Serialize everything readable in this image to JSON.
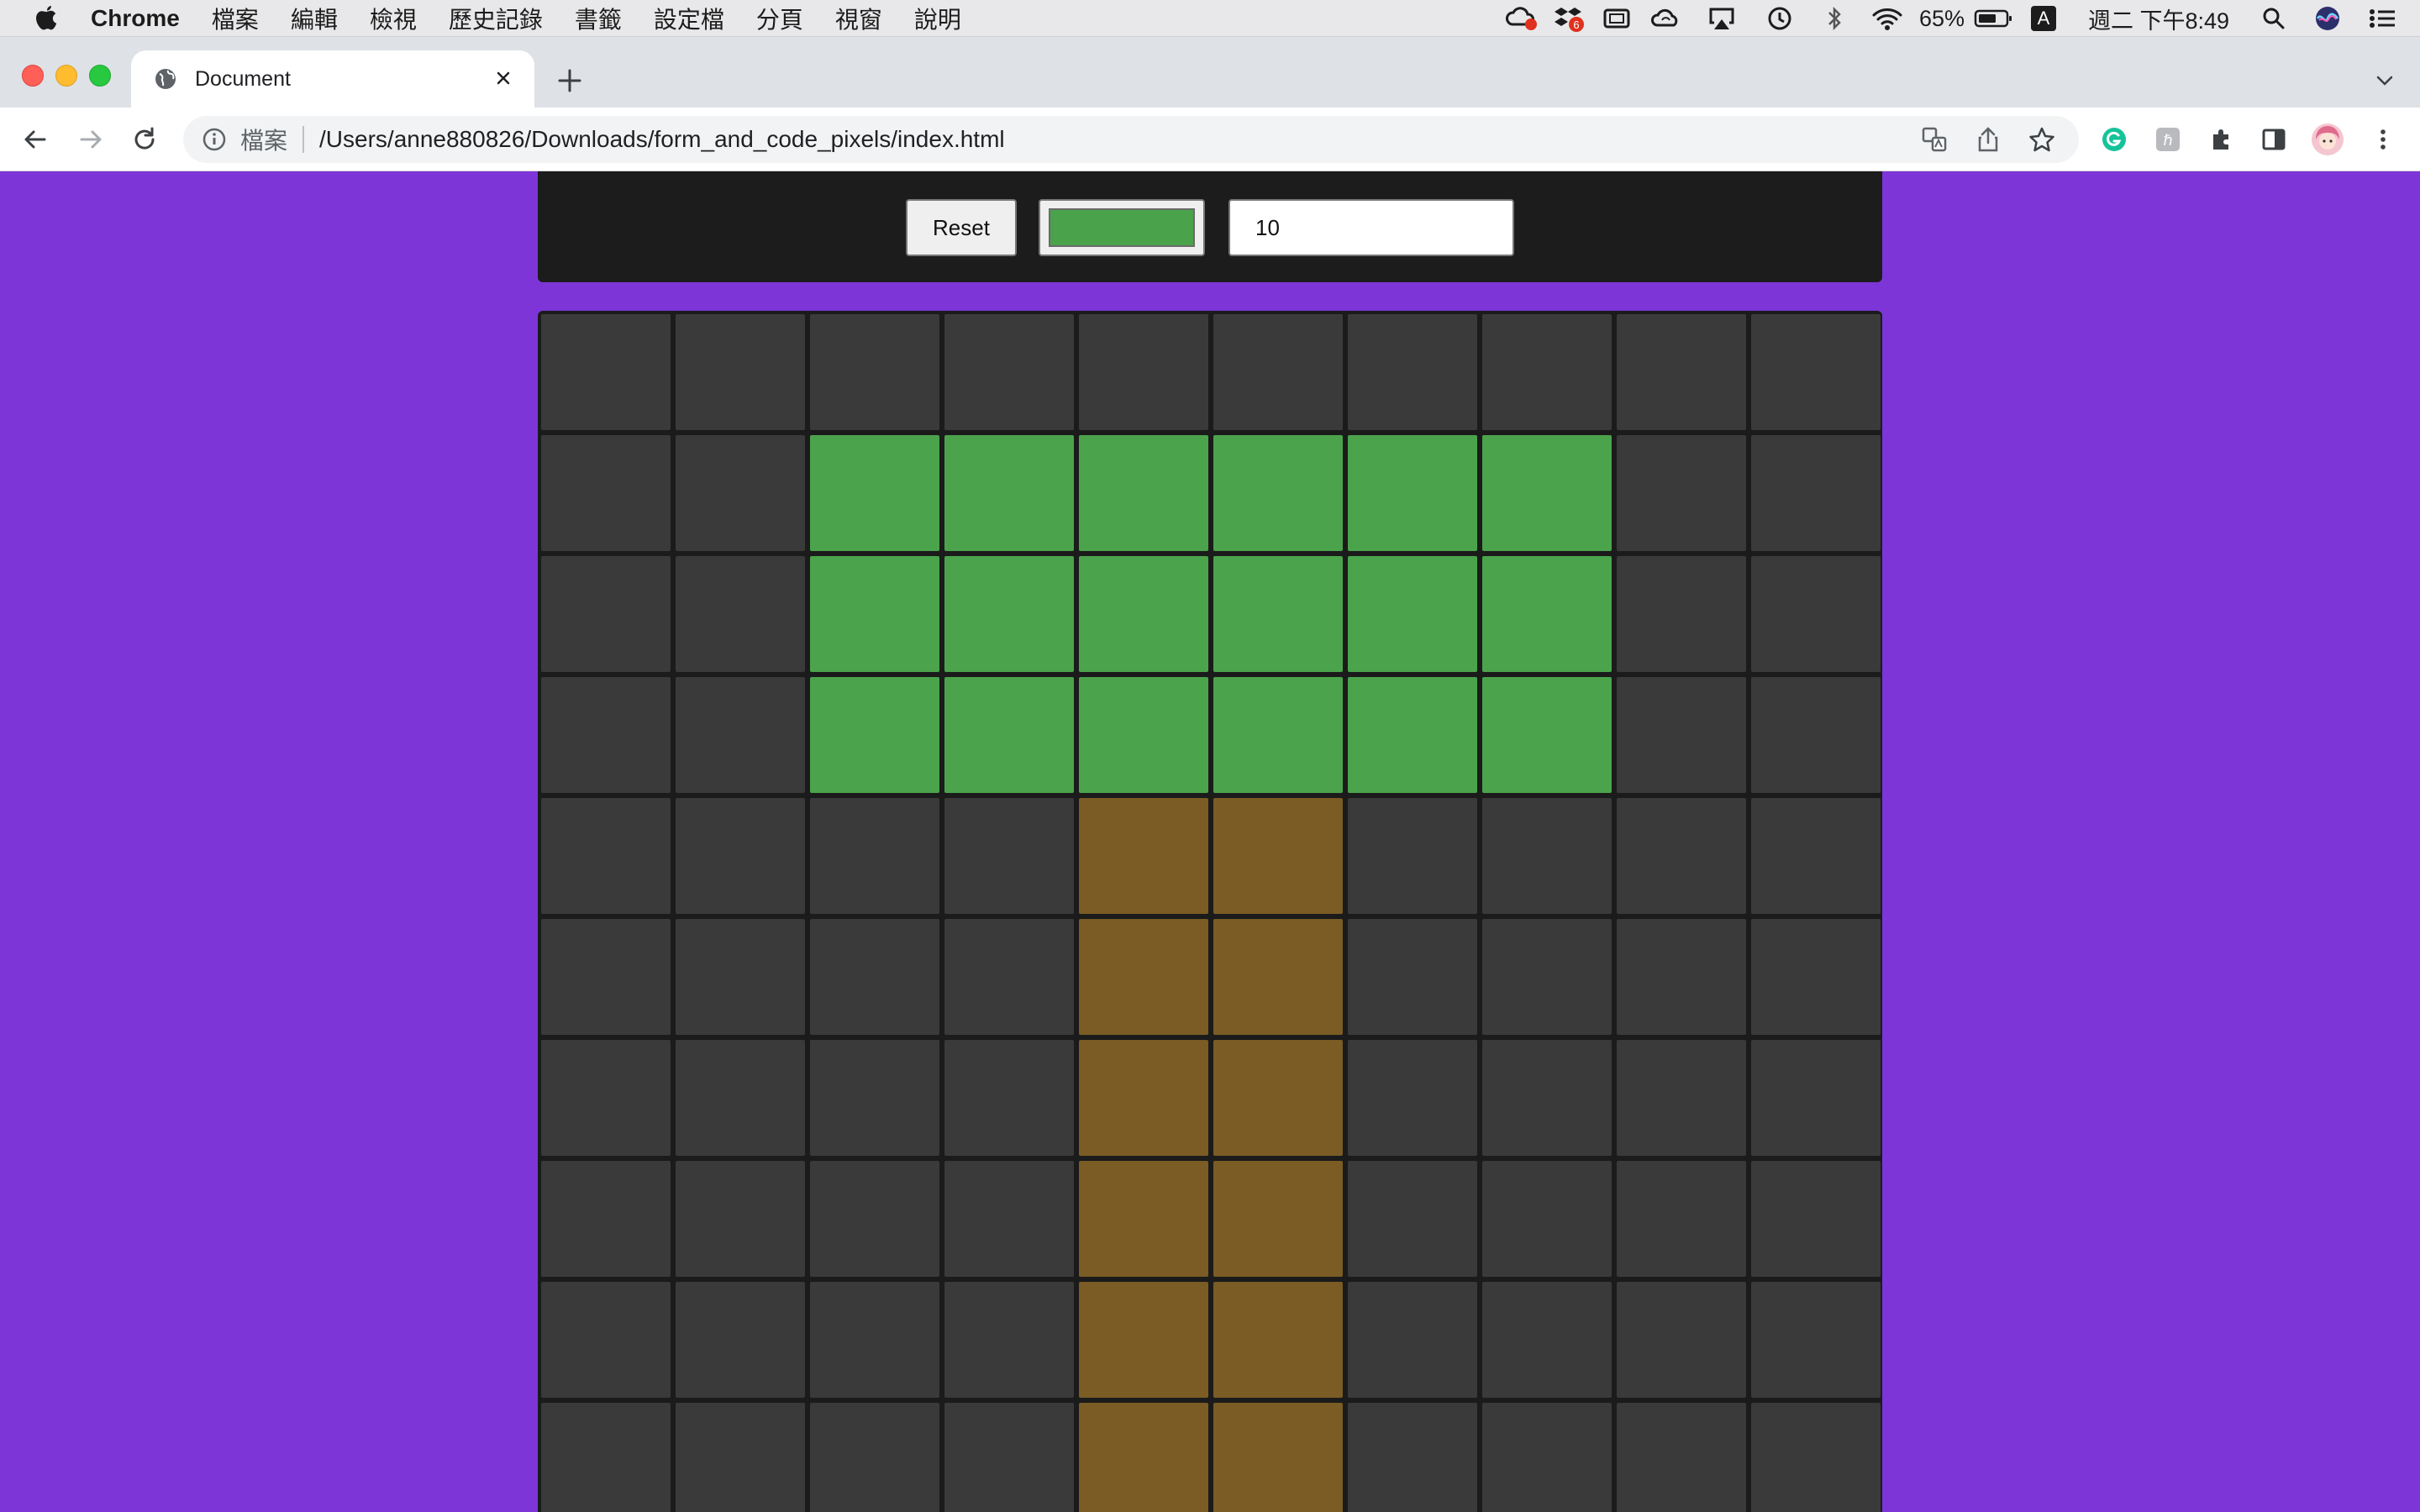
{
  "menubar": {
    "app_name": "Chrome",
    "items": [
      "檔案",
      "編輯",
      "檢視",
      "歷史記錄",
      "書籤",
      "設定檔",
      "分頁",
      "視窗",
      "說明"
    ],
    "notification_badge": "6",
    "battery_percent": "65%",
    "input_method": "A",
    "clock": "週二 下午8:49"
  },
  "tab": {
    "title": "Document"
  },
  "address_bar": {
    "scheme_label": "檔案",
    "url": "/Users/anne880826/Downloads/form_and_code_pixels/index.html"
  },
  "controls": {
    "reset_label": "Reset",
    "selected_color": "#4aa24a",
    "grid_size_value": "10"
  },
  "grid": {
    "size": 10,
    "empty_color": "#3a3a3a",
    "palette": {
      "G": "#4ba44b",
      "B": "#7a5c24"
    },
    "rows": [
      "..........",
      "..GGGGGG..",
      "..GGGGGG..",
      "..GGGGGG..",
      "....BB....",
      "....BB....",
      "....BB....",
      "....BB....",
      "....BB....",
      "....BB...."
    ]
  },
  "colors": {
    "page_background": "#7e35d8",
    "panel_background": "#1c1c1c"
  }
}
